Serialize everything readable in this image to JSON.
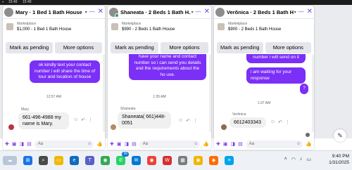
{
  "topbar": {
    "time1": "15:49",
    "time2": "15:49"
  },
  "chats": [
    {
      "title": "Mary · 1 Bed 1 Bath House",
      "marketplace_label": "Marketplace",
      "listing": "$1,000 - 1 Bed 1 Bath House",
      "btn_pending": "Mark as pending",
      "btn_more": "More options",
      "outgoing": "ok kindly text your contact number i will share the time of tour and location of house",
      "time": "12:57 AM",
      "sender": "Mary",
      "incoming": "661-496-4988 my name is Mary.",
      "input_placeholder": "Aa"
    },
    {
      "title": "Shaneata · 2 Beds 1 Bath H...",
      "marketplace_label": "Marketplace",
      "listing": "$990 - 2 Beds 1 Bath House",
      "btn_pending": "Mark as pending",
      "btn_more": "More options",
      "outgoing": "have your name and contact number so i can send you details and the requirements about the ho use.",
      "time": "1:35 AM",
      "sender": "Shaneata",
      "incoming": "Shaneata( 661)448-0051",
      "input_placeholder": "Aa"
    },
    {
      "title": "Verônica · 2 Beds 1 Bath Hou...",
      "marketplace_label": "Marketplace",
      "listing": "$900 - 2 Beds 1 Bath House",
      "btn_pending": "Mark as pending",
      "btn_more": "More options",
      "outgoing1": "number i will send on it",
      "outgoing2": "i am waiting for your response",
      "outgoing3": "?",
      "time": "1:37 AM",
      "sender": "Verônica",
      "incoming": "6612403343",
      "input_placeholder": "Aa"
    }
  ],
  "taskbar": {
    "clock_time": "9:40 PM",
    "clock_date": "1/31/2025",
    "badge": "36"
  },
  "colors": {
    "accent": "#7b2ff7",
    "header_icon": "#7b3fe4"
  }
}
